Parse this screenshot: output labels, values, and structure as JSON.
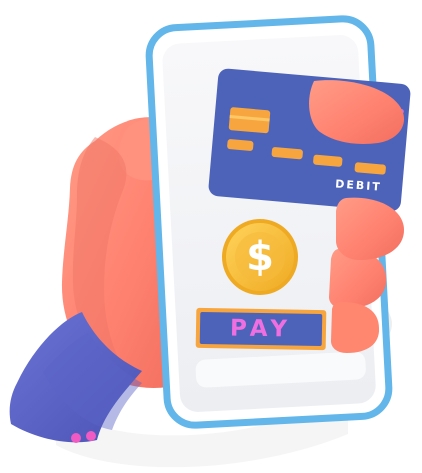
{
  "image": {
    "width": 422,
    "height": 473,
    "background": "#ffffff"
  },
  "phone": {
    "frame_color": "#62b6e9",
    "screen_color": "#f4f4f6"
  },
  "card": {
    "label": "DEBIT",
    "color": "#4d63b9",
    "chip_color": "#f7a63f",
    "stripe_color": "#c874d8"
  },
  "coin": {
    "symbol": "$",
    "color": "#f4b836"
  },
  "pay_button": {
    "label": "PAY",
    "bg_color": "#4d63b9",
    "border_color": "#f7a63f",
    "text_color": "#ef6fe0"
  },
  "hand": {
    "skin_color": "#ff8774"
  },
  "sleeve": {
    "color": "#5a64c7",
    "button_color": "#f05ac2"
  }
}
